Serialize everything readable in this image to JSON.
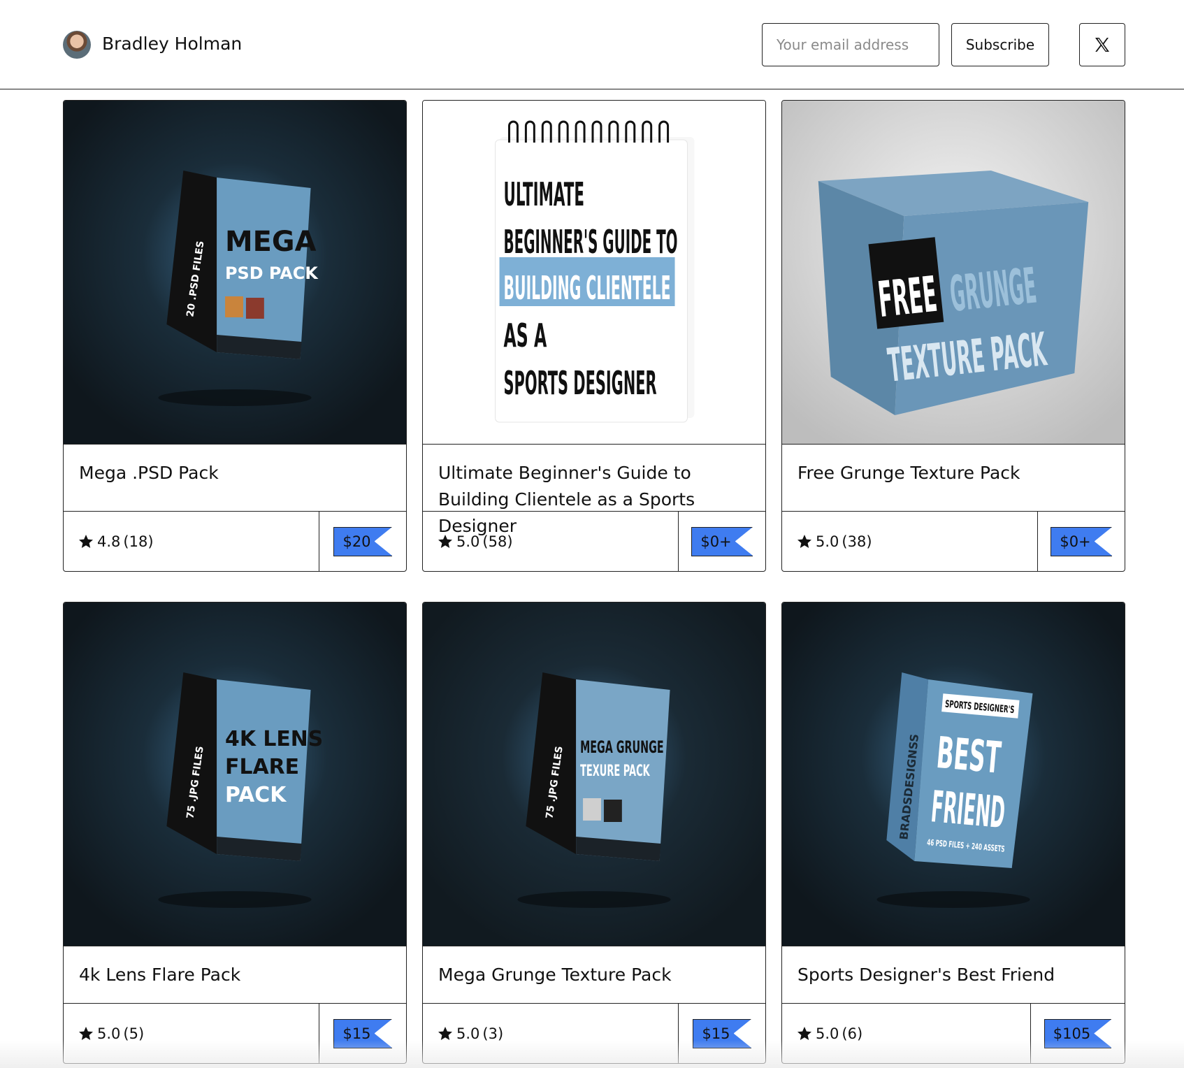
{
  "header": {
    "creator_name": "Bradley Holman",
    "email_placeholder": "Your email address",
    "subscribe_label": "Subscribe"
  },
  "products": [
    {
      "title": "Mega .PSD Pack",
      "rating": "4.8",
      "count": "(18)",
      "price": "$20",
      "art": {
        "line1": "MEGA",
        "line2": "PSD PACK",
        "side": "20 .PSD FILES"
      }
    },
    {
      "title": "Ultimate Beginner's Guide to Building Clientele as a Sports Designer",
      "rating": "5.0",
      "count": "(58)",
      "price": "$0+",
      "art": {
        "line1": "ULTIMATE",
        "line2": "BEGINNER'S GUIDE TO",
        "line3": "BUILDING CLIENTELE",
        "line4": "AS A",
        "line5": "SPORTS DESIGNER"
      }
    },
    {
      "title": "Free Grunge Texture Pack",
      "rating": "5.0",
      "count": "(38)",
      "price": "$0+",
      "art": {
        "line1": "FREE",
        "line2": "GRUNGE",
        "line3": "TEXTURE PACK"
      }
    },
    {
      "title": "4k Lens Flare Pack",
      "rating": "5.0",
      "count": "(5)",
      "price": "$15",
      "art": {
        "line1": "4K LENS",
        "line2": "FLARE",
        "line3": "PACK",
        "side": "75 .JPG FILES"
      }
    },
    {
      "title": "Mega Grunge Texture Pack",
      "rating": "5.0",
      "count": "(3)",
      "price": "$15",
      "art": {
        "line1": "MEGA GRUNGE",
        "line2": "TEXURE PACK",
        "side": "75 .JPG FILES"
      }
    },
    {
      "title": "Sports Designer's Best Friend",
      "rating": "5.0",
      "count": "(6)",
      "price": "$105",
      "art": {
        "line1": "SPORTS DESIGNER'S",
        "line2": "BEST",
        "line3": "FRIEND",
        "side": "BRADSDESIGNSS",
        "foot": "46 PSD FILES + 240 ASSETS"
      }
    }
  ],
  "colors": {
    "price_tag": "#3f7cf0",
    "box_blue": "#6a9cc0",
    "dark_bg": "#14202a"
  },
  "icons": [
    "star-icon",
    "x-logo-icon"
  ]
}
